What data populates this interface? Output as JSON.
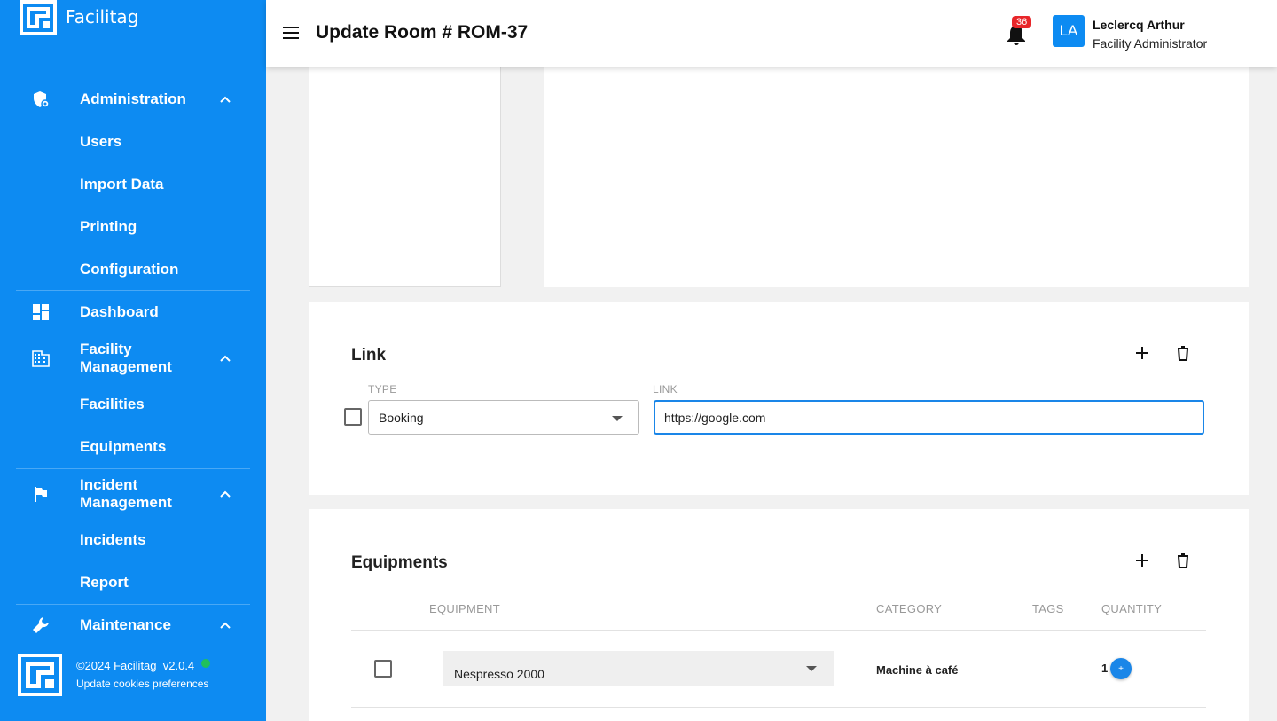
{
  "brand": {
    "name": "Facilitag"
  },
  "header": {
    "title": "Update Room # ROM-37",
    "notification_count": "36",
    "user_initials": "LA",
    "user_name": "Leclercq Arthur",
    "user_role": "Facility Administrator"
  },
  "sidebar": {
    "administration": {
      "label": "Administration",
      "icon": "shield-gear-icon",
      "items": [
        "Users",
        "Import Data",
        "Printing",
        "Configuration"
      ]
    },
    "dashboard": {
      "label": "Dashboard",
      "icon": "dashboard-icon"
    },
    "facility": {
      "label": "Facility Management",
      "icon": "building-icon",
      "items": [
        "Facilities",
        "Equipments"
      ]
    },
    "incident": {
      "label": "Incident Management",
      "icon": "flag-icon",
      "items": [
        "Incidents",
        "Report"
      ]
    },
    "maintenance": {
      "label": "Maintenance",
      "icon": "wrench-icon"
    }
  },
  "footer": {
    "copyright": "©2024 Facilitag  v2.0.4",
    "cookies": "Update cookies preferences",
    "status_color": "#20c05c"
  },
  "link_section": {
    "title": "Link",
    "type_label": "TYPE",
    "link_label": "LINK",
    "type_value": "Booking",
    "link_value": "https://google.com"
  },
  "equipments_section": {
    "title": "Equipments",
    "columns": [
      "EQUIPMENT",
      "CATEGORY",
      "TAGS",
      "QUANTITY"
    ],
    "rows": [
      {
        "equipment": "Nespresso 2000",
        "category": "Machine à café",
        "tags": "",
        "quantity": "1"
      }
    ]
  },
  "colors": {
    "sidebar": "#0d8bf2",
    "accent": "#1a86e8",
    "badge": "#e8262a"
  }
}
